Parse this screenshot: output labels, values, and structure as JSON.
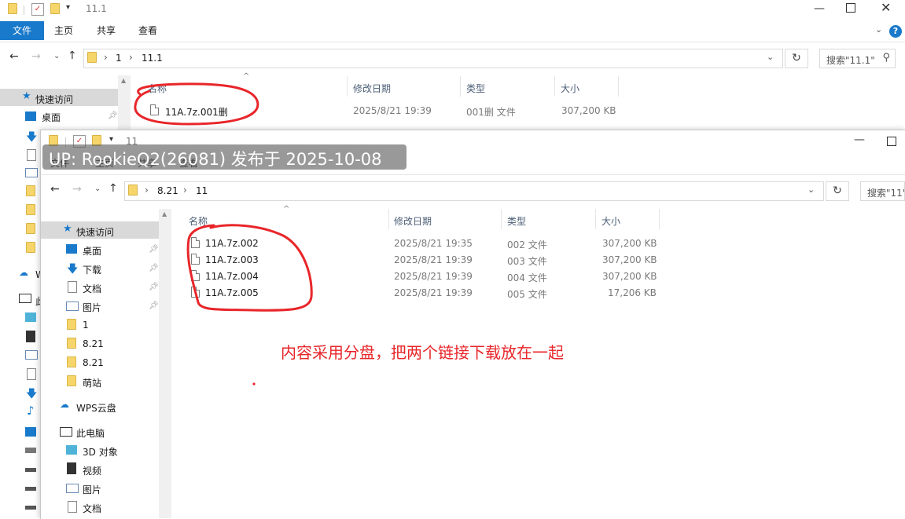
{
  "back_window": {
    "title": "11.1",
    "ribbon_tabs": [
      "文件",
      "主页",
      "共享",
      "查看"
    ],
    "breadcrumb": [
      "1",
      "11.1"
    ],
    "search_placeholder": "搜索\"11.1\"",
    "columns": [
      "名称",
      "修改日期",
      "类型",
      "大小"
    ],
    "files": [
      {
        "name": "11A.7z.001删",
        "date": "2025/8/21 19:39",
        "type": "001删 文件",
        "size": "307,200 KB"
      }
    ],
    "sidebar": {
      "quick_access": "快速访问",
      "desktop": "桌面",
      "wps_partial": "W",
      "pc_partial": "此"
    }
  },
  "front_window": {
    "title": "11",
    "ribbon_tabs": [
      "文件",
      "主页",
      "共享",
      "查看"
    ],
    "breadcrumb": [
      "8.21",
      "11"
    ],
    "search_placeholder": "搜索\"11\"",
    "columns": [
      "名称",
      "修改日期",
      "类型",
      "大小"
    ],
    "files": [
      {
        "name": "11A.7z.002",
        "date": "2025/8/21 19:35",
        "type": "002 文件",
        "size": "307,200 KB"
      },
      {
        "name": "11A.7z.003",
        "date": "2025/8/21 19:39",
        "type": "003 文件",
        "size": "307,200 KB"
      },
      {
        "name": "11A.7z.004",
        "date": "2025/8/21 19:39",
        "type": "004 文件",
        "size": "307,200 KB"
      },
      {
        "name": "11A.7z.005",
        "date": "2025/8/21 19:39",
        "type": "005 文件",
        "size": "17,206 KB"
      }
    ],
    "sidebar": {
      "quick_access": "快速访问",
      "desktop": "桌面",
      "downloads": "下载",
      "documents": "文档",
      "pictures": "图片",
      "folder_1": "1",
      "folder_821a": "8.21",
      "folder_821b": "8.21",
      "folder_mengzhan": "萌站",
      "wps_cloud": "WPS云盘",
      "this_pc": "此电脑",
      "objects3d": "3D 对象",
      "videos": "视频",
      "pictures2": "图片",
      "documents2": "文档"
    }
  },
  "overlay": {
    "watermark": "UP: RookieQ2(26081) 发布于 2025-10-08",
    "annotation": "内容采用分盘，把两个链接下载放在一起"
  },
  "colors": {
    "accent_blue": "#1979ca",
    "annotation_red": "#e8262a",
    "selected_gray": "#d9d9d9",
    "folder_yellow": "#f6d66b"
  }
}
